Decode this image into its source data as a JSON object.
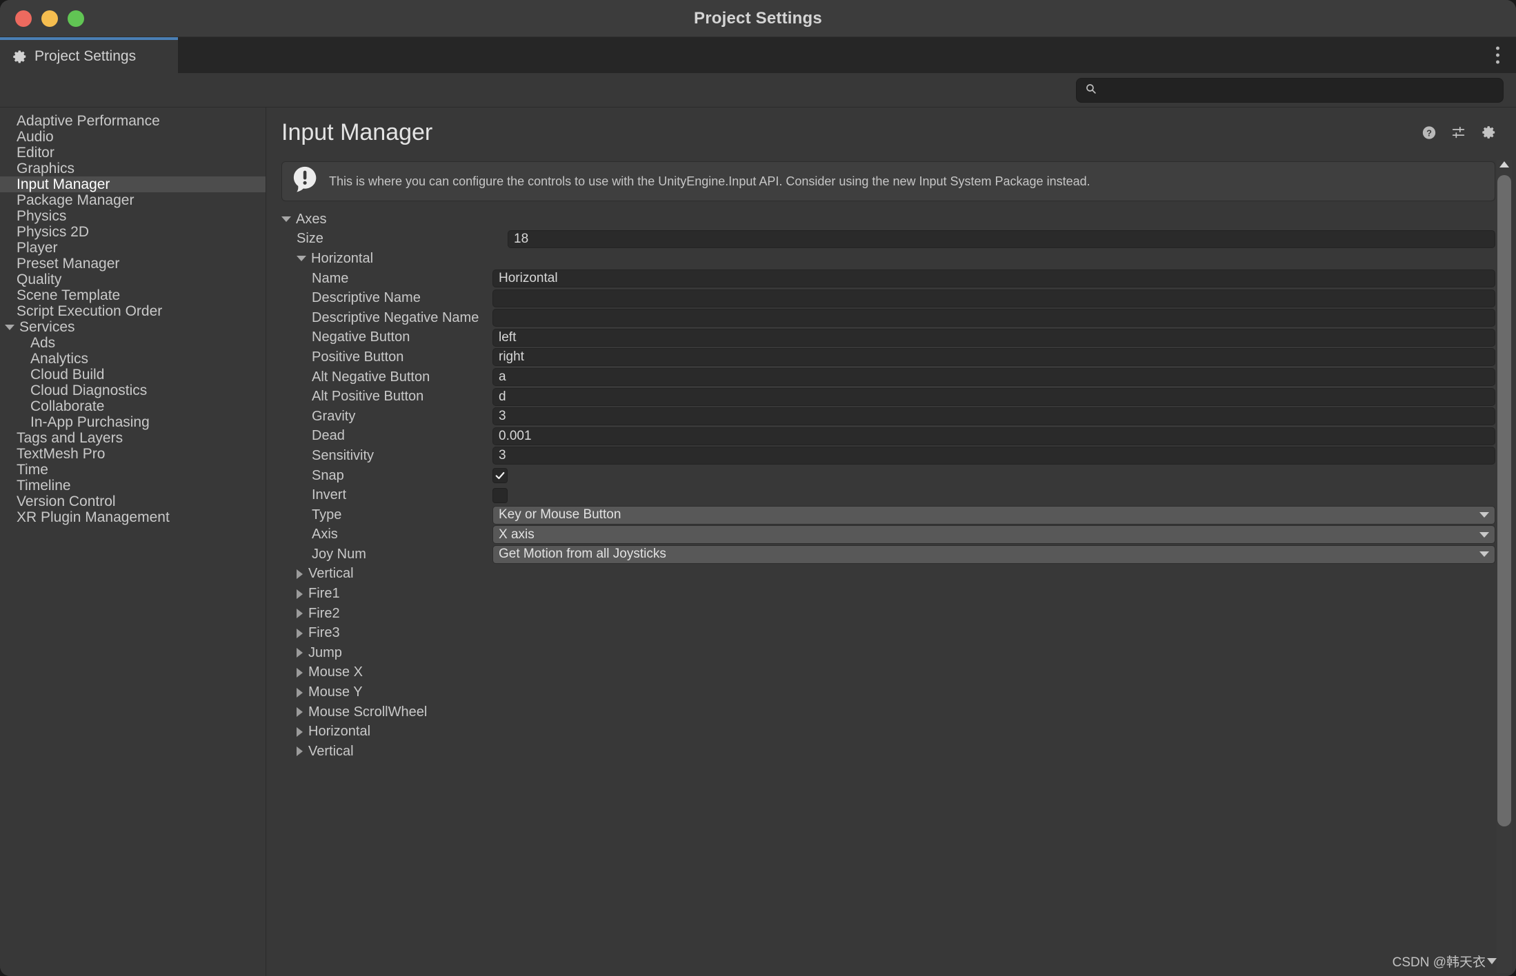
{
  "window": {
    "title": "Project Settings"
  },
  "tab": {
    "label": "Project Settings",
    "icon": "gear-icon"
  },
  "search": {
    "value": "",
    "placeholder": "",
    "icon": "search-icon"
  },
  "sidebar": {
    "items": [
      {
        "label": "Adaptive Performance",
        "level": 0,
        "selected": false,
        "expander": "none"
      },
      {
        "label": "Audio",
        "level": 0,
        "selected": false,
        "expander": "none"
      },
      {
        "label": "Editor",
        "level": 0,
        "selected": false,
        "expander": "none"
      },
      {
        "label": "Graphics",
        "level": 0,
        "selected": false,
        "expander": "none"
      },
      {
        "label": "Input Manager",
        "level": 0,
        "selected": true,
        "expander": "none"
      },
      {
        "label": "Package Manager",
        "level": 0,
        "selected": false,
        "expander": "none"
      },
      {
        "label": "Physics",
        "level": 0,
        "selected": false,
        "expander": "none"
      },
      {
        "label": "Physics 2D",
        "level": 0,
        "selected": false,
        "expander": "none"
      },
      {
        "label": "Player",
        "level": 0,
        "selected": false,
        "expander": "none"
      },
      {
        "label": "Preset Manager",
        "level": 0,
        "selected": false,
        "expander": "none"
      },
      {
        "label": "Quality",
        "level": 0,
        "selected": false,
        "expander": "none"
      },
      {
        "label": "Scene Template",
        "level": 0,
        "selected": false,
        "expander": "none"
      },
      {
        "label": "Script Execution Order",
        "level": 0,
        "selected": false,
        "expander": "none"
      },
      {
        "label": "Services",
        "level": 0,
        "selected": false,
        "expander": "expanded"
      },
      {
        "label": "Ads",
        "level": 1,
        "selected": false,
        "expander": "none"
      },
      {
        "label": "Analytics",
        "level": 1,
        "selected": false,
        "expander": "none"
      },
      {
        "label": "Cloud Build",
        "level": 1,
        "selected": false,
        "expander": "none"
      },
      {
        "label": "Cloud Diagnostics",
        "level": 1,
        "selected": false,
        "expander": "none"
      },
      {
        "label": "Collaborate",
        "level": 1,
        "selected": false,
        "expander": "none"
      },
      {
        "label": "In-App Purchasing",
        "level": 1,
        "selected": false,
        "expander": "none"
      },
      {
        "label": "Tags and Layers",
        "level": 0,
        "selected": false,
        "expander": "none"
      },
      {
        "label": "TextMesh Pro",
        "level": 0,
        "selected": false,
        "expander": "none"
      },
      {
        "label": "Time",
        "level": 0,
        "selected": false,
        "expander": "none"
      },
      {
        "label": "Timeline",
        "level": 0,
        "selected": false,
        "expander": "none"
      },
      {
        "label": "Version Control",
        "level": 0,
        "selected": false,
        "expander": "none"
      },
      {
        "label": "XR Plugin Management",
        "level": 0,
        "selected": false,
        "expander": "none"
      }
    ]
  },
  "content": {
    "title": "Input Manager",
    "header_icons": [
      {
        "name": "help-icon"
      },
      {
        "name": "preset-icon"
      },
      {
        "name": "settings-gear-icon"
      }
    ],
    "info": {
      "icon": "info-exclamation-icon",
      "message": "This is where you can configure the controls to use with the UnityEngine.Input API. Consider using the new Input System Package instead."
    },
    "rows": [
      {
        "kind": "foldout",
        "label": "Axes",
        "indent": 0,
        "expander": "expanded"
      },
      {
        "kind": "text",
        "label": "Size",
        "indent": 1,
        "value": "18"
      },
      {
        "kind": "foldout",
        "label": "Horizontal",
        "indent": 1,
        "expander": "expanded"
      },
      {
        "kind": "text",
        "label": "Name",
        "indent": 2,
        "value": "Horizontal"
      },
      {
        "kind": "text",
        "label": "Descriptive Name",
        "indent": 2,
        "value": ""
      },
      {
        "kind": "text",
        "label": "Descriptive Negative Name",
        "indent": 2,
        "value": ""
      },
      {
        "kind": "text",
        "label": "Negative Button",
        "indent": 2,
        "value": "left"
      },
      {
        "kind": "text",
        "label": "Positive Button",
        "indent": 2,
        "value": "right"
      },
      {
        "kind": "text",
        "label": "Alt Negative Button",
        "indent": 2,
        "value": "a"
      },
      {
        "kind": "text",
        "label": "Alt Positive Button",
        "indent": 2,
        "value": "d"
      },
      {
        "kind": "text",
        "label": "Gravity",
        "indent": 2,
        "value": "3"
      },
      {
        "kind": "text",
        "label": "Dead",
        "indent": 2,
        "value": "0.001"
      },
      {
        "kind": "text",
        "label": "Sensitivity",
        "indent": 2,
        "value": "3"
      },
      {
        "kind": "checkbox",
        "label": "Snap",
        "indent": 2,
        "checked": true
      },
      {
        "kind": "checkbox",
        "label": "Invert",
        "indent": 2,
        "checked": false
      },
      {
        "kind": "dropdown",
        "label": "Type",
        "indent": 2,
        "value": "Key or Mouse Button"
      },
      {
        "kind": "dropdown",
        "label": "Axis",
        "indent": 2,
        "value": "X axis"
      },
      {
        "kind": "dropdown",
        "label": "Joy Num",
        "indent": 2,
        "value": "Get Motion from all Joysticks"
      },
      {
        "kind": "foldout",
        "label": "Vertical",
        "indent": 1,
        "expander": "collapsed"
      },
      {
        "kind": "foldout",
        "label": "Fire1",
        "indent": 1,
        "expander": "collapsed"
      },
      {
        "kind": "foldout",
        "label": "Fire2",
        "indent": 1,
        "expander": "collapsed"
      },
      {
        "kind": "foldout",
        "label": "Fire3",
        "indent": 1,
        "expander": "collapsed"
      },
      {
        "kind": "foldout",
        "label": "Jump",
        "indent": 1,
        "expander": "collapsed"
      },
      {
        "kind": "foldout",
        "label": "Mouse X",
        "indent": 1,
        "expander": "collapsed"
      },
      {
        "kind": "foldout",
        "label": "Mouse Y",
        "indent": 1,
        "expander": "collapsed"
      },
      {
        "kind": "foldout",
        "label": "Mouse ScrollWheel",
        "indent": 1,
        "expander": "collapsed"
      },
      {
        "kind": "foldout",
        "label": "Horizontal",
        "indent": 1,
        "expander": "collapsed"
      },
      {
        "kind": "foldout",
        "label": "Vertical",
        "indent": 1,
        "expander": "collapsed"
      }
    ]
  },
  "watermark": {
    "text": "CSDN @韩天衣"
  },
  "colors": {
    "window_bg": "#383838",
    "tabstrip_bg": "#262626",
    "tab_accent": "#4a7fb5",
    "selection": "#4d4d4d",
    "field_bg": "#2a2a2a",
    "dropdown_bg": "#585858",
    "text": "#c9c9c9",
    "traffic_red": "#ed6a5f",
    "traffic_yellow": "#f5bd4f",
    "traffic_green": "#61c554"
  }
}
